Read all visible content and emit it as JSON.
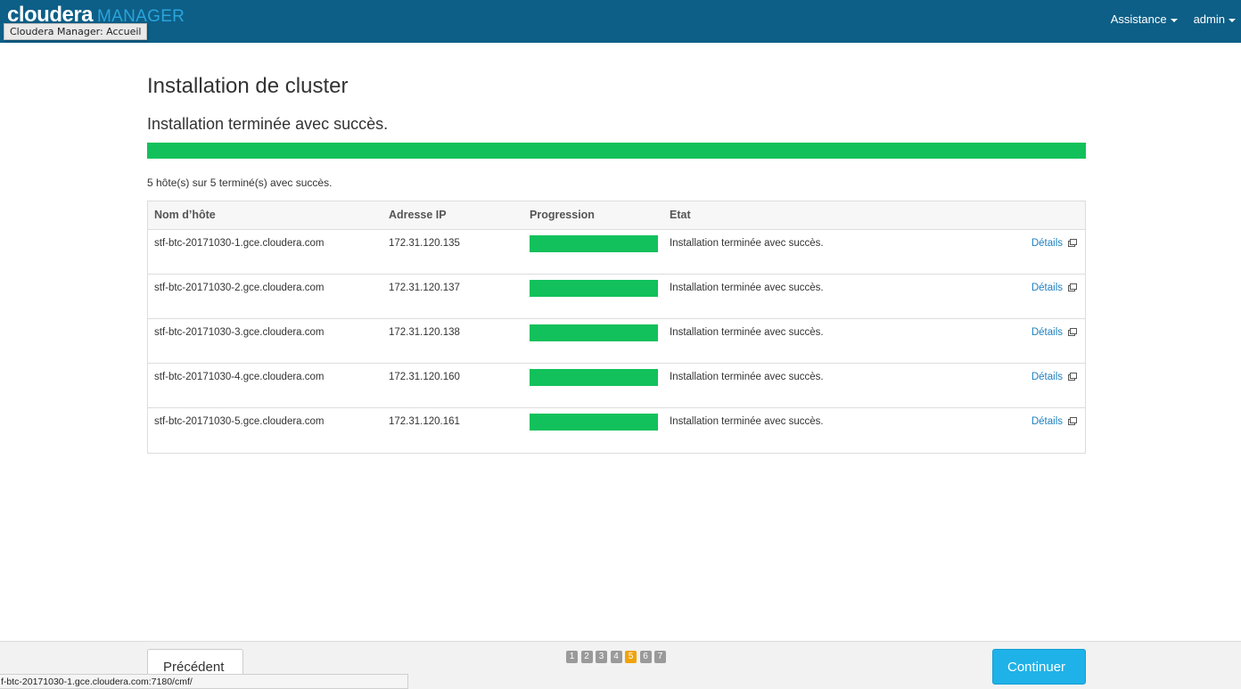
{
  "header": {
    "brand_primary": "cloudera",
    "brand_secondary": "MANAGER",
    "tooltip": "Cloudera Manager: Accueil",
    "menu": [
      "Assistance",
      "admin"
    ]
  },
  "page": {
    "title": "Installation de cluster",
    "subtitle": "Installation terminée avec succès.",
    "progress": 1.0,
    "summary": "5 hôte(s) sur 5 terminé(s) avec succès."
  },
  "table": {
    "columns": [
      "Nom d’hôte",
      "Adresse IP",
      "Progression",
      "Etat"
    ],
    "rows": [
      {
        "host": "stf-btc-20171030-1.gce.cloudera.com",
        "ip": "172.31.120.135",
        "progress": 1.0,
        "status": "Installation terminée avec succès.",
        "details": "Détails"
      },
      {
        "host": "stf-btc-20171030-2.gce.cloudera.com",
        "ip": "172.31.120.137",
        "progress": 1.0,
        "status": "Installation terminée avec succès.",
        "details": "Détails"
      },
      {
        "host": "stf-btc-20171030-3.gce.cloudera.com",
        "ip": "172.31.120.138",
        "progress": 1.0,
        "status": "Installation terminée avec succès.",
        "details": "Détails"
      },
      {
        "host": "stf-btc-20171030-4.gce.cloudera.com",
        "ip": "172.31.120.160",
        "progress": 1.0,
        "status": "Installation terminée avec succès.",
        "details": "Détails"
      },
      {
        "host": "stf-btc-20171030-5.gce.cloudera.com",
        "ip": "172.31.120.161",
        "progress": 1.0,
        "status": "Installation terminée avec succès.",
        "details": "Détails"
      }
    ]
  },
  "footer": {
    "prev_label": "Précédent",
    "next_label": "Continuer",
    "steps": [
      "1",
      "2",
      "3",
      "4",
      "5",
      "6",
      "7"
    ],
    "active_step": 5
  },
  "statusbar": "f-btc-20171030-1.gce.cloudera.com:7180/cmf/",
  "colors": {
    "header_bg": "#0d5f87",
    "accent": "#2aa4dd",
    "progress_green": "#12c15b",
    "primary_button": "#1fb2e8",
    "active_step": "#f0a30a",
    "link": "#1f80c0"
  }
}
